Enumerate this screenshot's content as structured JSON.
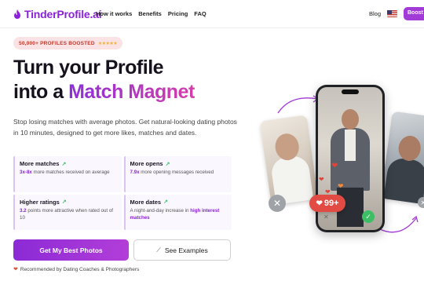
{
  "brand": {
    "name": "TinderProfile.ai",
    "color": "#8b21d8"
  },
  "nav": {
    "links": [
      "How it works",
      "Benefits",
      "Pricing",
      "FAQ"
    ],
    "blog": "Blog",
    "cta": "Boost"
  },
  "badge": {
    "text": "50,000+ PROFILES BOOSTED",
    "stars": "★★★★★"
  },
  "hero": {
    "title_line1": "Turn your Profile",
    "title_line2_prefix": "into a ",
    "title_line2_accent": "Match Magnet",
    "subtitle": "Stop losing matches with average photos. Get natural-looking dating photos in 10 minutes, designed to get more likes, matches and dates."
  },
  "stats": [
    {
      "title": "More matches",
      "highlight": "3x-8x",
      "desc": " more matches received on average"
    },
    {
      "title": "More opens",
      "highlight": "7.9x",
      "desc": " more opening messages received"
    },
    {
      "title": "Higher ratings",
      "highlight": "3.2",
      "desc": " points more attractive when rated out of 10"
    },
    {
      "title": "More dates",
      "prefix": "A night-and-day increase in ",
      "highlight": "high interest matches"
    }
  ],
  "cta": {
    "primary": "Get My Best Photos",
    "secondary": "See Examples",
    "recommend": "Recommended by Dating Coaches & Photographers"
  },
  "visual": {
    "match_count": "99+"
  },
  "icons": {
    "logo": "flame-icon",
    "flag": "us-flag-icon",
    "trend": "trending-up-icon",
    "wand": "magic-wand-icon",
    "heart": "heart-icon",
    "close": "close-icon",
    "check": "check-icon"
  },
  "colors": {
    "accent": "#8b21d8",
    "accent_pink": "#d43fa8",
    "badge_bg": "#fbe2e4",
    "match_red": "#e24a44",
    "success": "#3cbf64"
  }
}
